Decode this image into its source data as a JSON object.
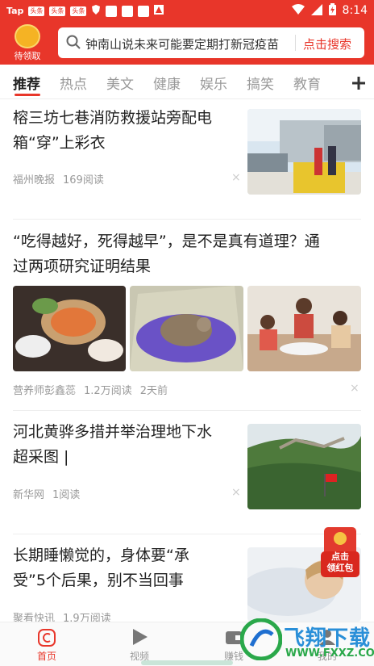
{
  "status": {
    "carrier": "Tap",
    "badges": [
      "头条",
      "头条",
      "头条"
    ],
    "time": "8:14"
  },
  "header": {
    "coin_label": "待领取",
    "search_text": "钟南山说未来可能要定期打新冠疫苗",
    "search_button": "点击搜索"
  },
  "tabs": [
    "推荐",
    "热点",
    "美文",
    "健康",
    "娱乐",
    "搞笑",
    "教育"
  ],
  "feed": [
    {
      "title_lines": [
        "榕三坊七巷消防救援站旁配电",
        "箱“穿”上彩衣"
      ],
      "source": "福州晚报",
      "reads": "169阅读",
      "time": ""
    },
    {
      "title_lines": [
        "“吃得越好，死得越早”，是不是真有道理？通",
        "过两项研究证明结果"
      ],
      "source": "营养师彭鑫蕊",
      "reads": "1.2万阅读",
      "time": "2天前"
    },
    {
      "title_lines": [
        "河北黄骅多措并举治理地下水",
        "超采图 |"
      ],
      "source": "新华网",
      "reads": "1阅读",
      "time": ""
    },
    {
      "title_lines": [
        "长期睡懒觉的，身体要“承",
        "受”5个后果，别不当回事"
      ],
      "source": "聚看快讯",
      "reads": "1.9万阅读",
      "time": ""
    }
  ],
  "close_glyph": "×",
  "promo": {
    "line1": "点击",
    "line2": "领红包"
  },
  "bottom_nav": [
    "首页",
    "视频",
    "赚钱",
    "我的"
  ],
  "watermark": {
    "brand": "飞翔下载",
    "url": "WWW.FXXZ.COM"
  },
  "colors": {
    "brand_red": "#e8362a",
    "text": "#222222",
    "muted": "#999999"
  }
}
